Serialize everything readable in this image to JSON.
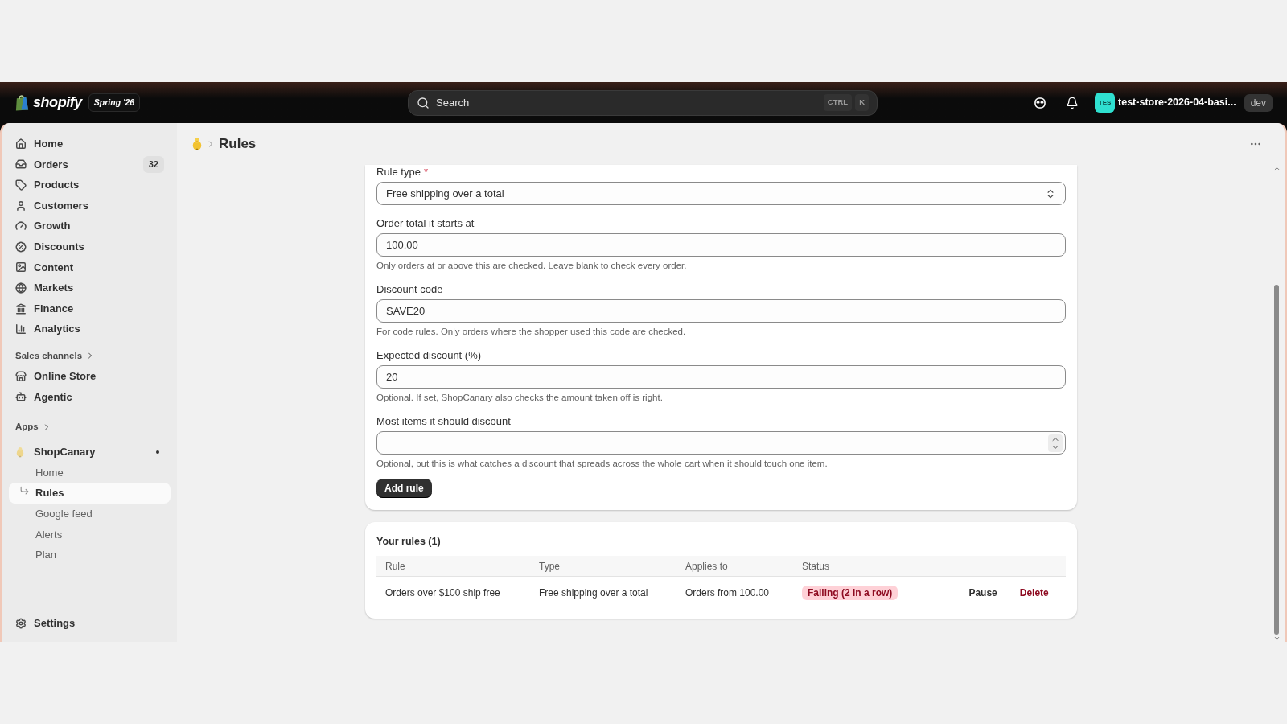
{
  "top_bar": {
    "logo_text": "shopify",
    "edition": "Spring '26",
    "search": {
      "placeholder": "Search",
      "keys": [
        "CTRL",
        "K"
      ]
    },
    "store": {
      "avatar": "TES",
      "name": "test-store-2026-04-basi...",
      "env": "dev"
    }
  },
  "sidebar": {
    "main_items": [
      {
        "label": "Home"
      },
      {
        "label": "Orders",
        "badge": "32"
      },
      {
        "label": "Products"
      },
      {
        "label": "Customers"
      },
      {
        "label": "Growth"
      },
      {
        "label": "Discounts"
      },
      {
        "label": "Content"
      },
      {
        "label": "Markets"
      },
      {
        "label": "Finance"
      },
      {
        "label": "Analytics"
      }
    ],
    "sales_channels": {
      "label": "Sales channels",
      "items": [
        {
          "label": "Online Store"
        },
        {
          "label": "Agentic"
        }
      ]
    },
    "apps": {
      "label": "Apps",
      "items": [
        {
          "label": "ShopCanary",
          "pinned_dot": true,
          "children": [
            {
              "label": "Home",
              "selected": false
            },
            {
              "label": "Rules",
              "selected": true
            },
            {
              "label": "Google feed",
              "selected": false
            },
            {
              "label": "Alerts",
              "selected": false
            },
            {
              "label": "Plan",
              "selected": false
            }
          ]
        }
      ]
    },
    "settings": {
      "label": "Settings"
    }
  },
  "page": {
    "title": "Rules"
  },
  "form": {
    "fields": [
      {
        "kind": "select",
        "label": "Rule type",
        "required_mark": "*",
        "value": "Free shipping over a total"
      },
      {
        "kind": "text",
        "label": "Order total it starts at",
        "value": "100.00",
        "help": "Only orders at or above this are checked. Leave blank to check every order."
      },
      {
        "kind": "text",
        "label": "Discount code",
        "value": "SAVE20",
        "help": "For code rules. Only orders where the shopper used this code are checked."
      },
      {
        "kind": "text",
        "label": "Expected discount (%)",
        "value": "20",
        "help": "Optional. If set, ShopCanary also checks the amount taken off is right."
      },
      {
        "kind": "number",
        "label": "Most items it should discount",
        "help": "Optional, but this is what catches a discount that spreads across the whole cart when it should touch one item."
      }
    ],
    "submit": "Add rule"
  },
  "rules": {
    "title": "Your rules (1)",
    "columns": [
      "Rule",
      "Type",
      "Applies to",
      "Status"
    ],
    "rows": [
      {
        "rule": "Orders over $100 ship free",
        "type": "Free shipping over a total",
        "applies_to": "Orders from 100.00",
        "status": {
          "label": "Failing (2 in a row)",
          "color": "#fed1d7"
        },
        "actions": [
          {
            "label": "Pause",
            "color": "#303030"
          },
          {
            "label": "Delete",
            "color": "#8e0b21"
          }
        ]
      }
    ]
  }
}
